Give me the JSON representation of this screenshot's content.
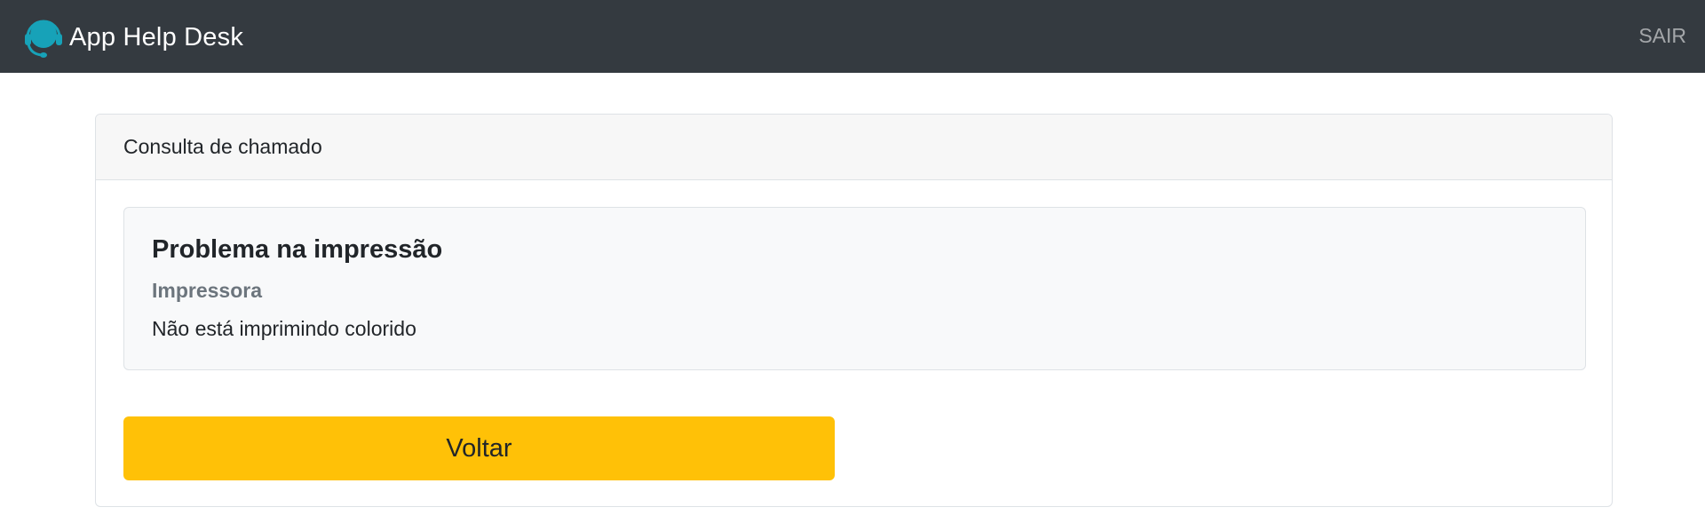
{
  "navbar": {
    "brand": "App Help Desk",
    "logo_icon": "headset-icon",
    "exit_label": "SAIR"
  },
  "card": {
    "header": "Consulta de chamado",
    "ticket": {
      "title": "Problema na impressão",
      "category": "Impressora",
      "description": "Não está imprimindo colorido"
    },
    "back_button_label": "Voltar"
  },
  "colors": {
    "navbar_bg": "#343a40",
    "logo_accent": "#17a2b8",
    "button_warning": "#ffc107",
    "muted_text": "#6c757d"
  }
}
